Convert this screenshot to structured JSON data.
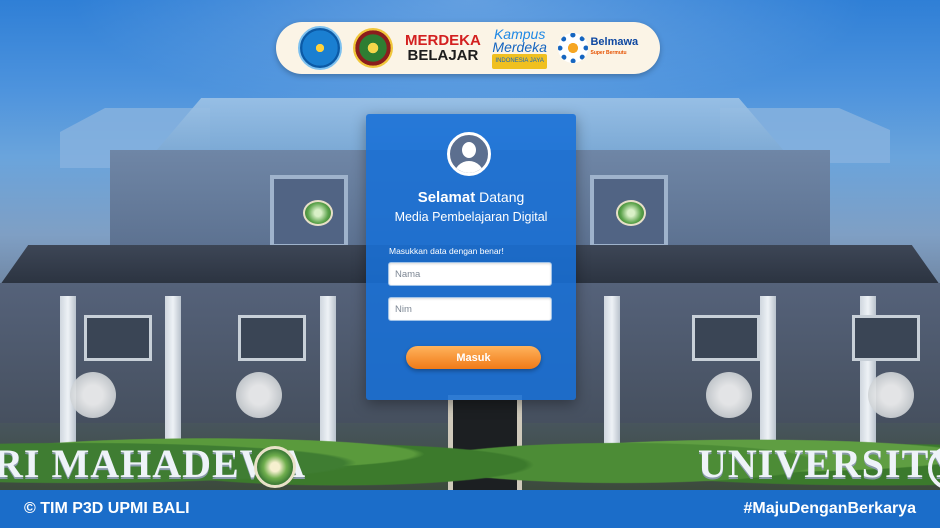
{
  "logos": {
    "merdeka_belajar": {
      "line1": "MERDEKA",
      "line2": "BELAJAR"
    },
    "kampus_merdeka": {
      "line1": "Kampus",
      "line2": "Merdeka",
      "line3": "INDONESIA JAYA"
    },
    "belmawa": {
      "name": "Belmawa",
      "sub": "Super Bermutu"
    }
  },
  "background": {
    "sign_left": "RI MAHADEWA",
    "sign_right": "UNIVERSITY"
  },
  "login": {
    "welcome_bold": "Selamat",
    "welcome_rest": " Datang",
    "subtitle": "Media Pembelajaran Digital",
    "hint": "Masukkan data dengan benar!",
    "name_placeholder": "Nama",
    "nim_placeholder": "Nim",
    "submit_label": "Masuk"
  },
  "footer": {
    "copyright": "© TIM P3D UPMI BALI",
    "hashtag": "#MajuDenganBerkarya"
  },
  "colors": {
    "card": "#1870d6",
    "button": "#f07a18",
    "footer": "#1b6dc9",
    "logo_bar": "#fbf4e6"
  }
}
